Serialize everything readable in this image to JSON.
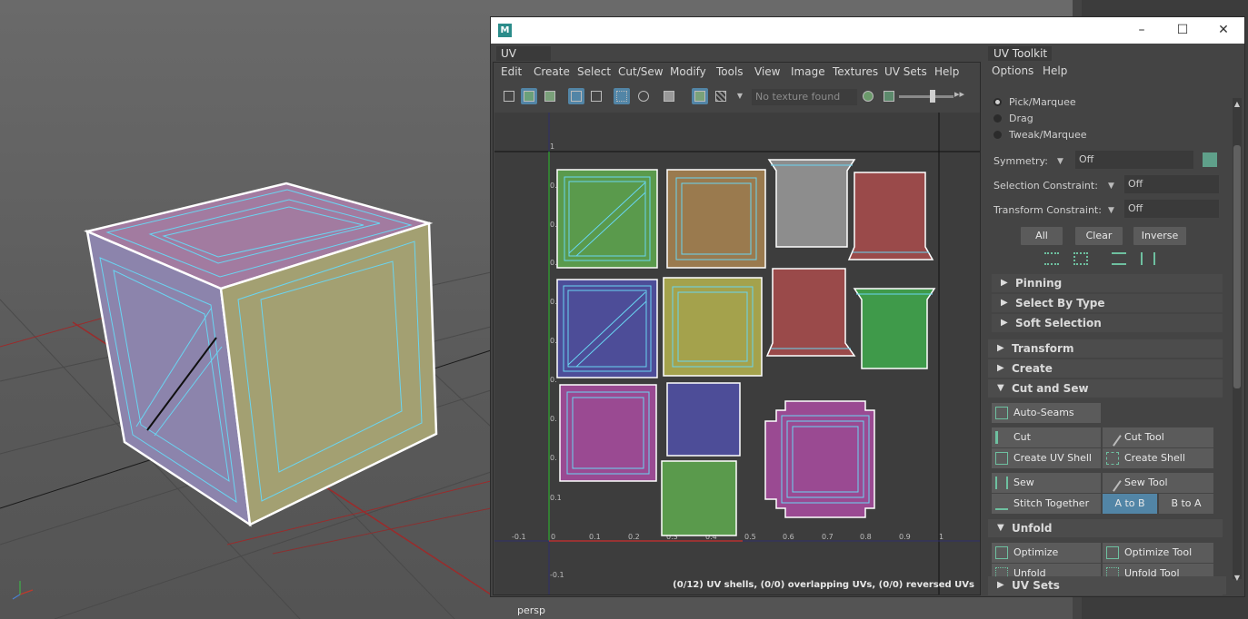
{
  "viewport": {
    "camera_label": "persp"
  },
  "window": {
    "logo": "M"
  },
  "uv_editor": {
    "tab": "UV Editor",
    "menu": [
      "Edit",
      "Create",
      "Select",
      "Cut/Sew",
      "Modify",
      "Tools",
      "View",
      "Image",
      "Textures",
      "UV Sets",
      "Help"
    ],
    "texture_field": "No texture found",
    "axis_x_ticks": [
      "-0.1",
      "0",
      "0.1",
      "0.2",
      "0.3",
      "0.4",
      "0.5",
      "0.6",
      "0.7",
      "0.8",
      "0.9",
      "1"
    ],
    "axis_y_ticks": [
      "1",
      "0.",
      "0.",
      "0.",
      "0.",
      "0.",
      "0.",
      "0.",
      "0.",
      "0.1",
      "-0.1"
    ],
    "status": "(0/12) UV shells, (0/0) overlapping UVs, (0/0) reversed UVs",
    "shell_colors": [
      "#5a9a4c",
      "#9a7a4e",
      "#8d8d8d",
      "#9a4a4a",
      "#4d4d98",
      "#a4a24c",
      "#9a4a92",
      "#3f9a4a"
    ]
  },
  "toolkit": {
    "tab": "UV Toolkit",
    "menu": [
      "Options",
      "Help"
    ],
    "modes": [
      "Pick/Marquee",
      "Drag",
      "Tweak/Marquee"
    ],
    "symmetry": {
      "label": "Symmetry:",
      "value": "Off"
    },
    "selection_constraint": {
      "label": "Selection Constraint:",
      "value": "Off"
    },
    "transform_constraint": {
      "label": "Transform Constraint:",
      "value": "Off"
    },
    "select_buttons": [
      "All",
      "Clear",
      "Inverse"
    ],
    "subsections": [
      "Pinning",
      "Select By Type",
      "Soft Selection"
    ],
    "sections": [
      "Transform",
      "Create",
      "Cut and Sew"
    ],
    "auto_seams": "Auto-Seams",
    "cut": "Cut",
    "cut_tool": "Cut Tool",
    "create_uv_shell": "Create UV Shell",
    "create_shell_grid": "Create Shell (Grid)",
    "sew": "Sew",
    "sew_tool": "Sew Tool",
    "stitch_together": "Stitch Together",
    "a_to_b": "A to B",
    "b_to_a": "B to A",
    "unfold_section": "Unfold",
    "optimize": "Optimize",
    "optimize_tool": "Optimize Tool",
    "unfold": "Unfold",
    "unfold_tool": "Unfold Tool",
    "uv_sets": "UV Sets"
  }
}
